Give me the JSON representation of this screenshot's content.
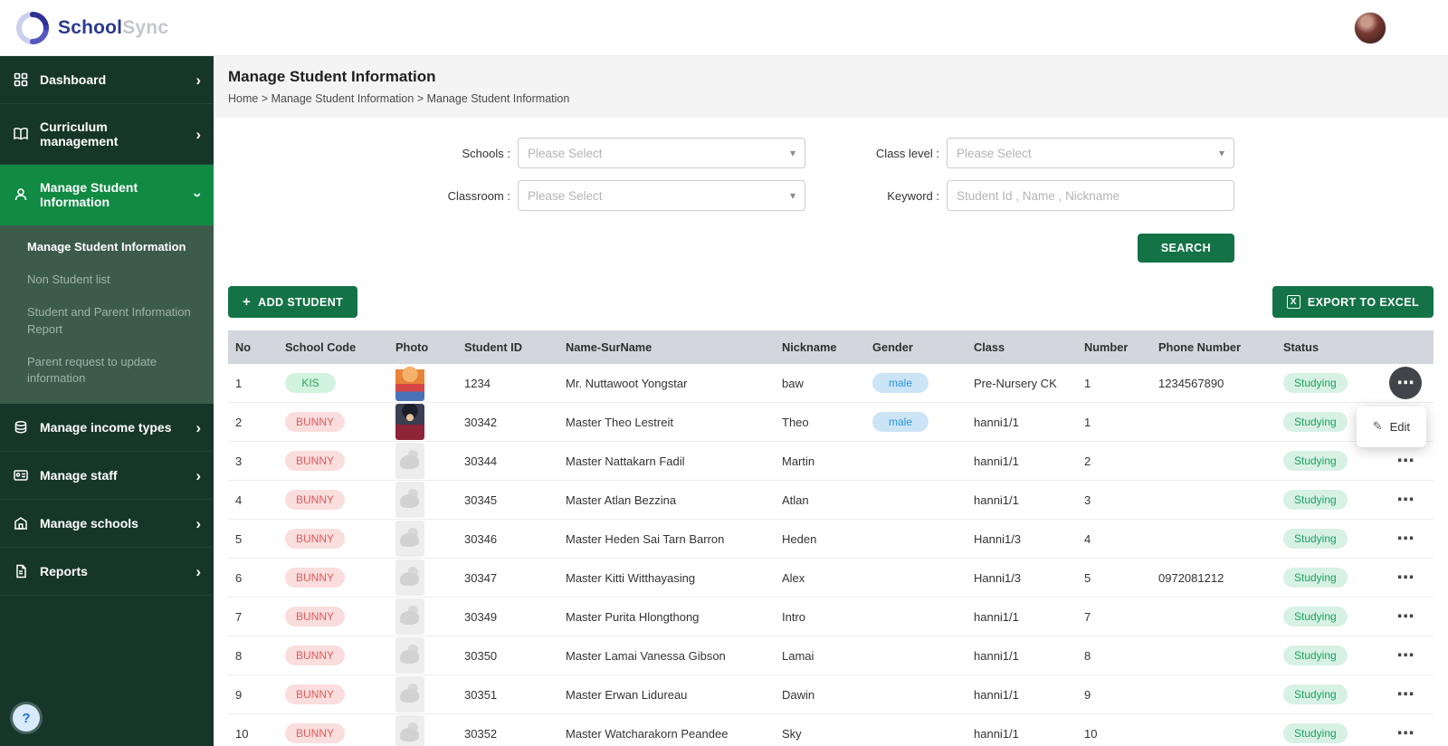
{
  "brand": {
    "primary": "School",
    "secondary": "Sync"
  },
  "icons": {
    "chevron": "›",
    "caret": "▾",
    "dots": "⋯",
    "pencil": "✎",
    "excel": "X",
    "help": "?"
  },
  "sidebar": {
    "items": [
      {
        "label": "Dashboard"
      },
      {
        "label": "Curriculum management"
      },
      {
        "label": "Manage Student Information",
        "active": true
      },
      {
        "label": "Manage income types"
      },
      {
        "label": "Manage staff"
      },
      {
        "label": "Manage schools"
      },
      {
        "label": "Reports"
      }
    ],
    "submenu": [
      {
        "label": "Manage Student Information",
        "active": true
      },
      {
        "label": "Non Student list"
      },
      {
        "label": "Student and Parent Information Report"
      },
      {
        "label": "Parent request to update information"
      }
    ],
    "help_icon": "?"
  },
  "page": {
    "title": "Manage Student Information",
    "breadcrumb": "Home > Manage Student Information > Manage Student Information"
  },
  "filters": {
    "schools_label": "Schools :",
    "schools_placeholder": "Please Select",
    "classroom_label": "Classroom :",
    "classroom_placeholder": "Please Select",
    "class_level_label": "Class level :",
    "class_level_placeholder": "Please Select",
    "keyword_label": "Keyword :",
    "keyword_placeholder": "Student Id , Name , Nickname",
    "search_label": "SEARCH"
  },
  "toolbar": {
    "add_icon": "+",
    "add_label": "ADD STUDENT",
    "export_label": "EXPORT TO EXCEL"
  },
  "menu": {
    "edit_label": "Edit"
  },
  "table": {
    "headers": [
      "No",
      "School Code",
      "Photo",
      "Student ID",
      "Name-SurName",
      "Nickname",
      "Gender",
      "Class",
      "Number",
      "Phone Number",
      "Status",
      ""
    ],
    "rows": [
      {
        "no": "1",
        "school_code": "KIS",
        "code_color": "green",
        "photo": "cartoon",
        "student_id": "1234",
        "name": "Mr. Nuttawoot Yongstar",
        "nickname": "baw",
        "gender": "male",
        "class": "Pre-Nursery CK",
        "number": "1",
        "phone": "1234567890",
        "status": "Studying"
      },
      {
        "no": "2",
        "school_code": "BUNNY",
        "code_color": "red",
        "photo": "anime",
        "student_id": "30342",
        "name": "Master Theo Lestreit",
        "nickname": "Theo",
        "gender": "male",
        "class": "hanni1/1",
        "number": "1",
        "phone": "",
        "status": "Studying"
      },
      {
        "no": "3",
        "school_code": "BUNNY",
        "code_color": "red",
        "photo": "placeholder",
        "student_id": "30344",
        "name": "Master Nattakarn Fadil",
        "nickname": "Martin",
        "gender": "",
        "class": "hanni1/1",
        "number": "2",
        "phone": "",
        "status": "Studying"
      },
      {
        "no": "4",
        "school_code": "BUNNY",
        "code_color": "red",
        "photo": "placeholder",
        "student_id": "30345",
        "name": "Master Atlan Bezzina",
        "nickname": "Atlan",
        "gender": "",
        "class": "hanni1/1",
        "number": "3",
        "phone": "",
        "status": "Studying"
      },
      {
        "no": "5",
        "school_code": "BUNNY",
        "code_color": "red",
        "photo": "placeholder",
        "student_id": "30346",
        "name": "Master Heden Sai Tarn Barron",
        "nickname": "Heden",
        "gender": "",
        "class": "Hanni1/3",
        "number": "4",
        "phone": "",
        "status": "Studying"
      },
      {
        "no": "6",
        "school_code": "BUNNY",
        "code_color": "red",
        "photo": "placeholder",
        "student_id": "30347",
        "name": "Master Kitti Witthayasing",
        "nickname": "Alex",
        "gender": "",
        "class": "Hanni1/3",
        "number": "5",
        "phone": "0972081212",
        "status": "Studying"
      },
      {
        "no": "7",
        "school_code": "BUNNY",
        "code_color": "red",
        "photo": "placeholder",
        "student_id": "30349",
        "name": "Master Purita Hlongthong",
        "nickname": "Intro",
        "gender": "",
        "class": "hanni1/1",
        "number": "7",
        "phone": "",
        "status": "Studying"
      },
      {
        "no": "8",
        "school_code": "BUNNY",
        "code_color": "red",
        "photo": "placeholder",
        "student_id": "30350",
        "name": "Master Lamai Vanessa Gibson",
        "nickname": "Lamai",
        "gender": "",
        "class": "hanni1/1",
        "number": "8",
        "phone": "",
        "status": "Studying"
      },
      {
        "no": "9",
        "school_code": "BUNNY",
        "code_color": "red",
        "photo": "placeholder",
        "student_id": "30351",
        "name": "Master Erwan Lidureau",
        "nickname": "Dawin",
        "gender": "",
        "class": "hanni1/1",
        "number": "9",
        "phone": "",
        "status": "Studying"
      },
      {
        "no": "10",
        "school_code": "BUNNY",
        "code_color": "red",
        "photo": "placeholder",
        "student_id": "30352",
        "name": "Master Watcharakorn Peandee",
        "nickname": "Sky",
        "gender": "",
        "class": "hanni1/1",
        "number": "10",
        "phone": "",
        "status": "Studying"
      }
    ]
  }
}
